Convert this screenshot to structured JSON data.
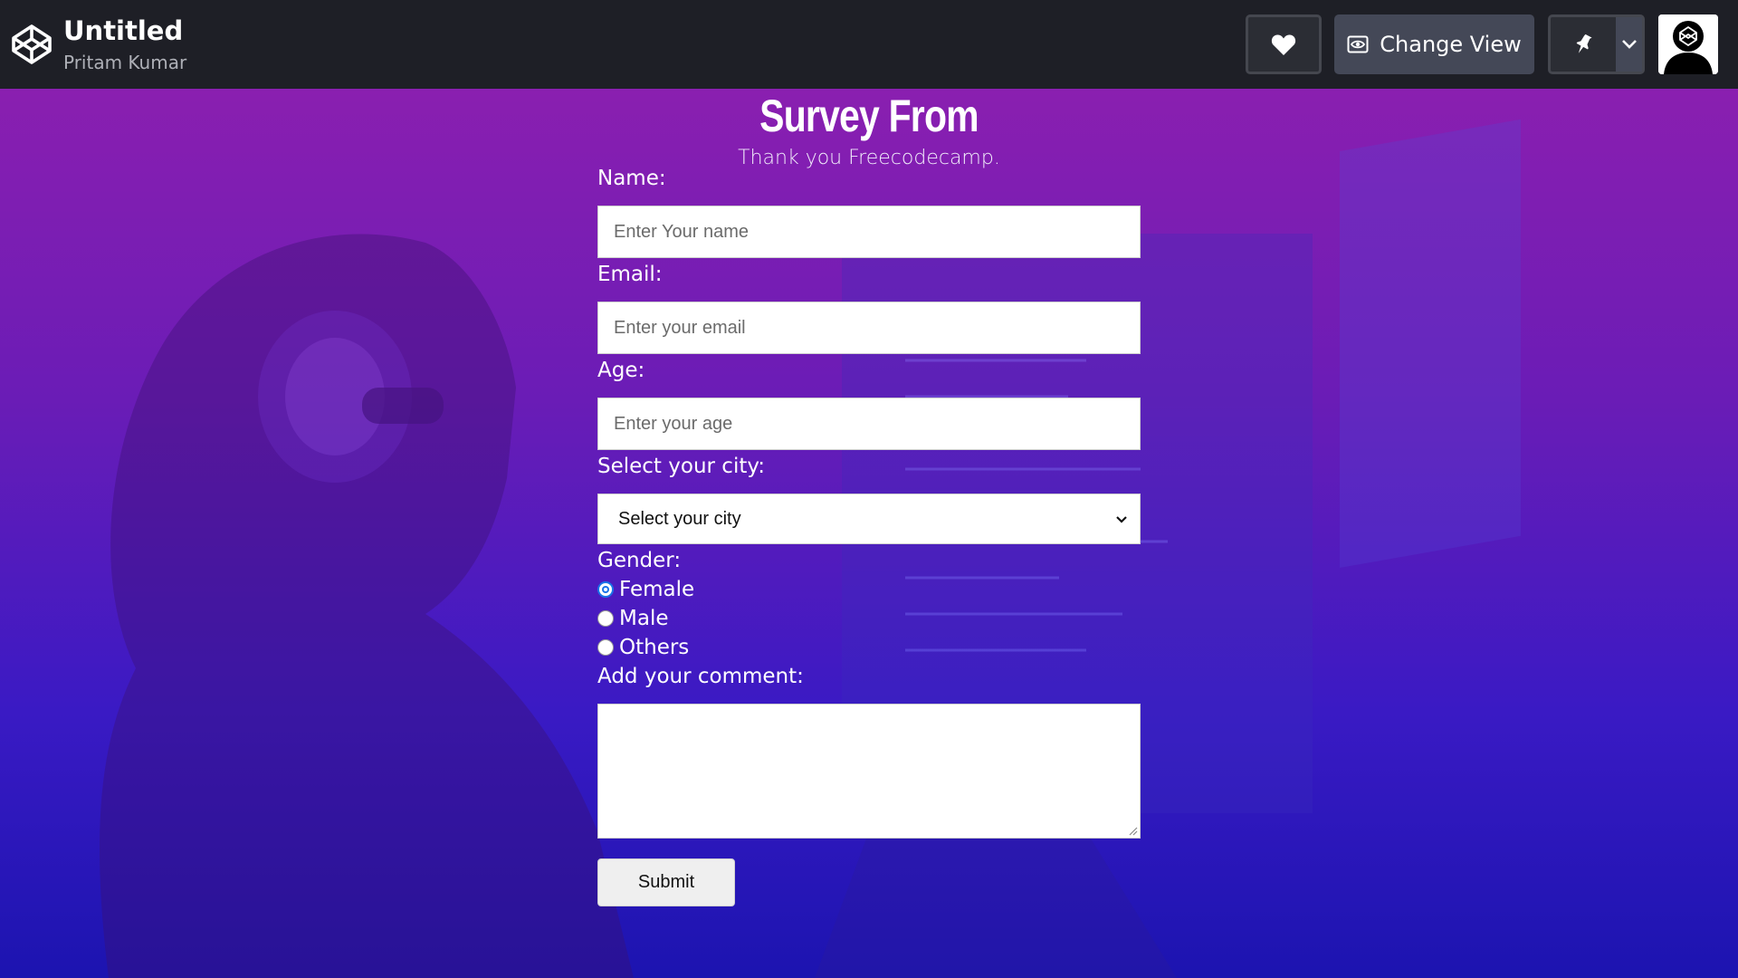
{
  "header": {
    "title": "Untitled",
    "author": "Pritam Kumar",
    "change_view_label": "Change View"
  },
  "form": {
    "title": "Survey From",
    "subtitle": "Thank you Freecodecamp.",
    "name": {
      "label": "Name:",
      "placeholder": "Enter Your name"
    },
    "email": {
      "label": "Email:",
      "placeholder": "Enter your email"
    },
    "age": {
      "label": "Age:",
      "placeholder": "Enter your age"
    },
    "city": {
      "label": "Select your city:",
      "selected": "Select your city"
    },
    "gender": {
      "label": "Gender:",
      "options": [
        {
          "label": "Female",
          "checked": true
        },
        {
          "label": "Male",
          "checked": false
        },
        {
          "label": "Others",
          "checked": false
        }
      ]
    },
    "comment": {
      "label": "Add your comment:",
      "value": ""
    },
    "submit_label": "Submit"
  },
  "colors": {
    "header_bg": "#1e1f26",
    "button_bg": "#444857",
    "gradient_top": "#8a1fb0",
    "gradient_bottom": "#1c14b0",
    "radio_accent": "#1a73e8"
  },
  "icons": [
    "codepen-logo-icon",
    "heart-icon",
    "eye-icon",
    "pin-icon",
    "chevron-down-icon",
    "avatar-icon"
  ]
}
